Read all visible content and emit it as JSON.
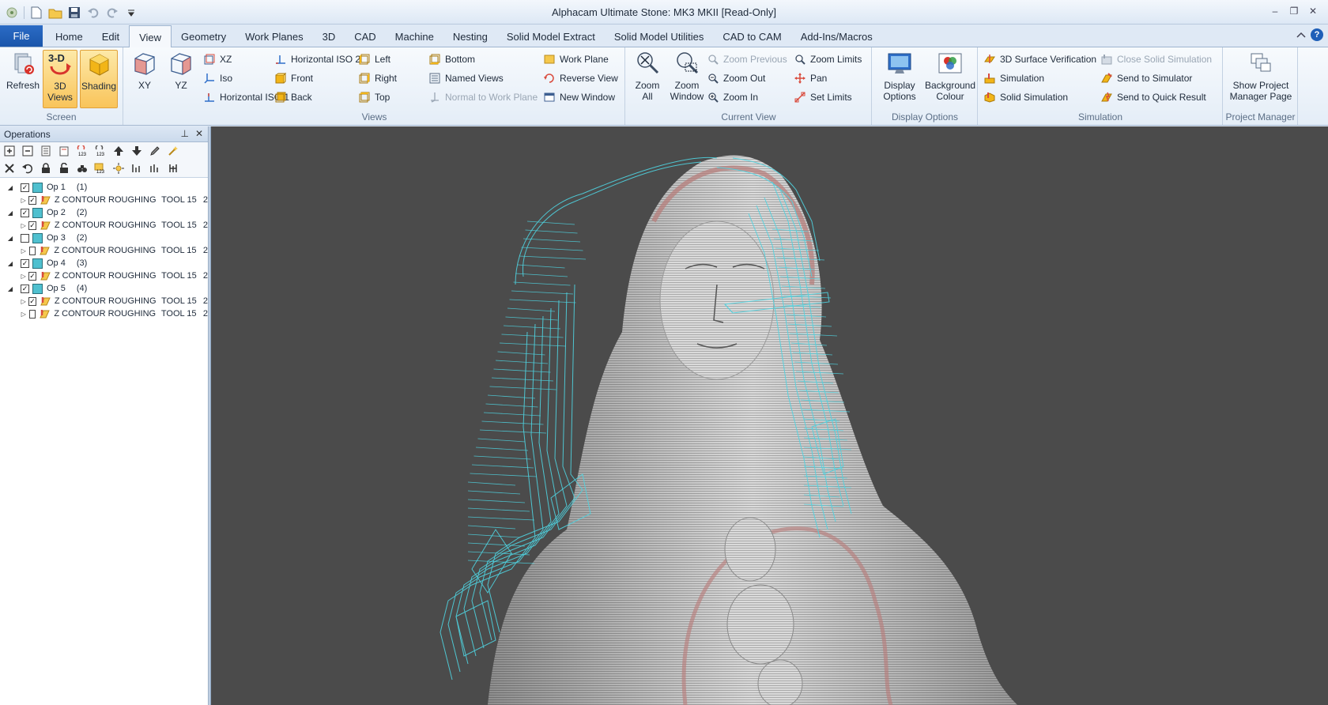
{
  "window": {
    "title": "Alphacam Ultimate Stone: MK3   MKII [Read-Only]",
    "min": "–",
    "max": "❐",
    "close": "✕"
  },
  "menu": {
    "file": "File",
    "tabs": [
      "Home",
      "Edit",
      "View",
      "Geometry",
      "Work Planes",
      "3D",
      "CAD",
      "Machine",
      "Nesting",
      "Solid Model Extract",
      "Solid Model Utilities",
      "CAD to CAM",
      "Add-Ins/Macros"
    ],
    "active_tab": "View",
    "help": "?"
  },
  "ribbon": {
    "screen": {
      "label": "Screen",
      "refresh": "Refresh",
      "views3d": "3D\nViews",
      "views3d_line1": "3D",
      "views3d_line2": "Views",
      "shading": "Shading"
    },
    "views": {
      "label": "Views",
      "xy": "XY",
      "yz": "YZ",
      "xz": "XZ",
      "iso": "Iso",
      "hiso1": "Horizontal ISO 1",
      "hiso2": "Horizontal ISO 2",
      "front": "Front",
      "back": "Back",
      "left": "Left",
      "right": "Right",
      "top": "Top",
      "bottom": "Bottom",
      "named": "Named Views",
      "normal": "Normal to Work Plane",
      "workplane": "Work Plane",
      "reverse": "Reverse View",
      "newwindow": "New Window"
    },
    "current_view": {
      "label": "Current View",
      "zoom_all_1": "Zoom",
      "zoom_all_2": "All",
      "zoom_window_1": "Zoom",
      "zoom_window_2": "Window",
      "zoom_previous": "Zoom Previous",
      "zoom_out": "Zoom Out",
      "zoom_in": "Zoom In",
      "zoom_limits": "Zoom Limits",
      "pan": "Pan",
      "set_limits": "Set Limits"
    },
    "display": {
      "label": "Display Options",
      "display_1": "Display",
      "display_2": "Options",
      "bg_1": "Background",
      "bg_2": "Colour"
    },
    "simulation": {
      "label": "Simulation",
      "surface_verification": "3D Surface Verification",
      "simulation": "Simulation",
      "solid_simulation": "Solid Simulation",
      "close_solid": "Close Solid Simulation",
      "send_simulator": "Send to Simulator",
      "send_quick": "Send to Quick Result"
    },
    "project": {
      "label": "Project Manager",
      "show_1": "Show Project",
      "show_2": "Manager Page"
    }
  },
  "operations": {
    "title": "Operations",
    "pin": "📌",
    "close": "✕",
    "rows": [
      {
        "type": "op",
        "name": "Op 1",
        "num": "(1)",
        "checked": true
      },
      {
        "type": "tp",
        "name": "Z CONTOUR ROUGHING",
        "tool": "TOOL 15",
        "n": "2",
        "checked": true
      },
      {
        "type": "op",
        "name": "Op 2",
        "num": "(2)",
        "checked": true
      },
      {
        "type": "tp",
        "name": "Z CONTOUR ROUGHING",
        "tool": "TOOL 15",
        "n": "2",
        "checked": true
      },
      {
        "type": "op",
        "name": "Op 3",
        "num": "(2)",
        "checked": false
      },
      {
        "type": "tp",
        "name": "Z CONTOUR ROUGHING",
        "tool": "TOOL 15",
        "n": "2",
        "checked": false
      },
      {
        "type": "op",
        "name": "Op 4",
        "num": "(3)",
        "checked": true
      },
      {
        "type": "tp",
        "name": "Z CONTOUR ROUGHING",
        "tool": "TOOL 15",
        "n": "2",
        "checked": true
      },
      {
        "type": "op",
        "name": "Op 5",
        "num": "(4)",
        "checked": true
      },
      {
        "type": "tp",
        "name": "Z CONTOUR ROUGHING",
        "tool": "TOOL 15",
        "n": "2",
        "checked": true
      },
      {
        "type": "tp",
        "name": "Z CONTOUR ROUGHING",
        "tool": "TOOL 15",
        "n": "2",
        "checked": false
      }
    ]
  },
  "colors": {
    "accent": "#1f5fb8",
    "toolpath": "#4fd3e0",
    "model": "#d8d8d8",
    "viewport_bg": "#4b4b4b"
  }
}
